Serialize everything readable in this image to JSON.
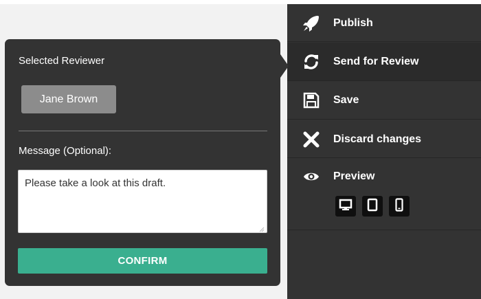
{
  "sidebar": {
    "items": [
      {
        "label": "Publish",
        "icon": "rocket-icon"
      },
      {
        "label": "Send for Review",
        "icon": "refresh-icon"
      },
      {
        "label": "Save",
        "icon": "floppy-disk-icon"
      },
      {
        "label": "Discard changes",
        "icon": "close-x-icon"
      },
      {
        "label": "Preview",
        "icon": "eye-icon"
      }
    ],
    "preview_devices": [
      "desktop-icon",
      "tablet-icon",
      "mobile-icon"
    ]
  },
  "review_panel": {
    "title": "Selected Reviewer",
    "reviewer": "Jane Brown",
    "message_label": "Message (Optional):",
    "message_value": "Please take a look at this draft.",
    "confirm_label": "CONFIRM"
  },
  "colors": {
    "sidebar_bg": "#333333",
    "panel_bg": "#333333",
    "confirm_bg": "#3aaf8f",
    "reviewer_chip_bg": "#8c8c8c",
    "page_bg": "#f2f2f2"
  }
}
